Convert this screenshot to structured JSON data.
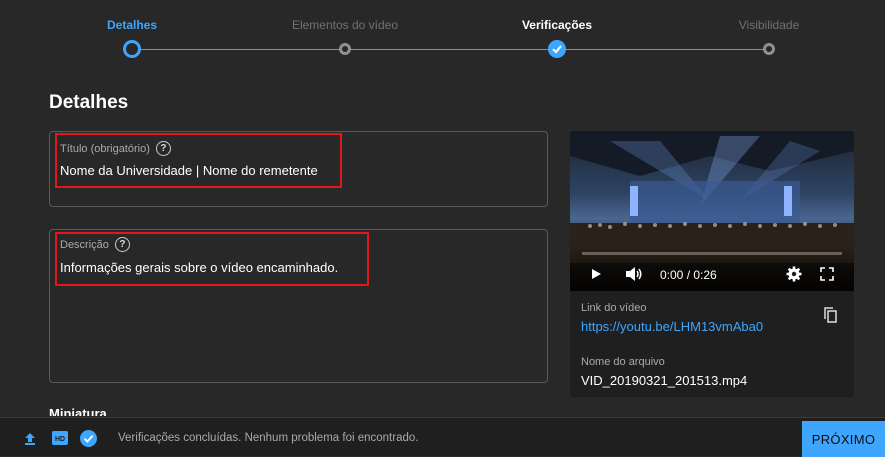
{
  "stepper": {
    "steps": [
      {
        "label": "Detalhes",
        "state": "active"
      },
      {
        "label": "Elementos do vídeo",
        "state": "pending"
      },
      {
        "label": "Verificações",
        "state": "done"
      },
      {
        "label": "Visibilidade",
        "state": "pending"
      }
    ]
  },
  "details": {
    "title": "Detalhes",
    "title_field": {
      "label": "Título (obrigatório)",
      "value": "Nome da Universidade | Nome do remetente"
    },
    "description_field": {
      "label": "Descrição",
      "value": "Informações gerais sobre o vídeo encaminhado."
    },
    "thumbnail_heading": "Miniatura"
  },
  "video": {
    "time": "0:00 / 0:26",
    "link_label": "Link do vídeo",
    "link": "https://youtu.be/LHM13vmAba0",
    "file_label": "Nome do arquivo",
    "file_name": "VID_20190321_201513.mp4"
  },
  "footer": {
    "status": "Verificações concluídas. Nenhum problema foi encontrado.",
    "next_button": "PRÓXIMO"
  },
  "colors": {
    "accent": "#3ea6ff",
    "background": "#282828",
    "highlight": "#e3161c"
  }
}
